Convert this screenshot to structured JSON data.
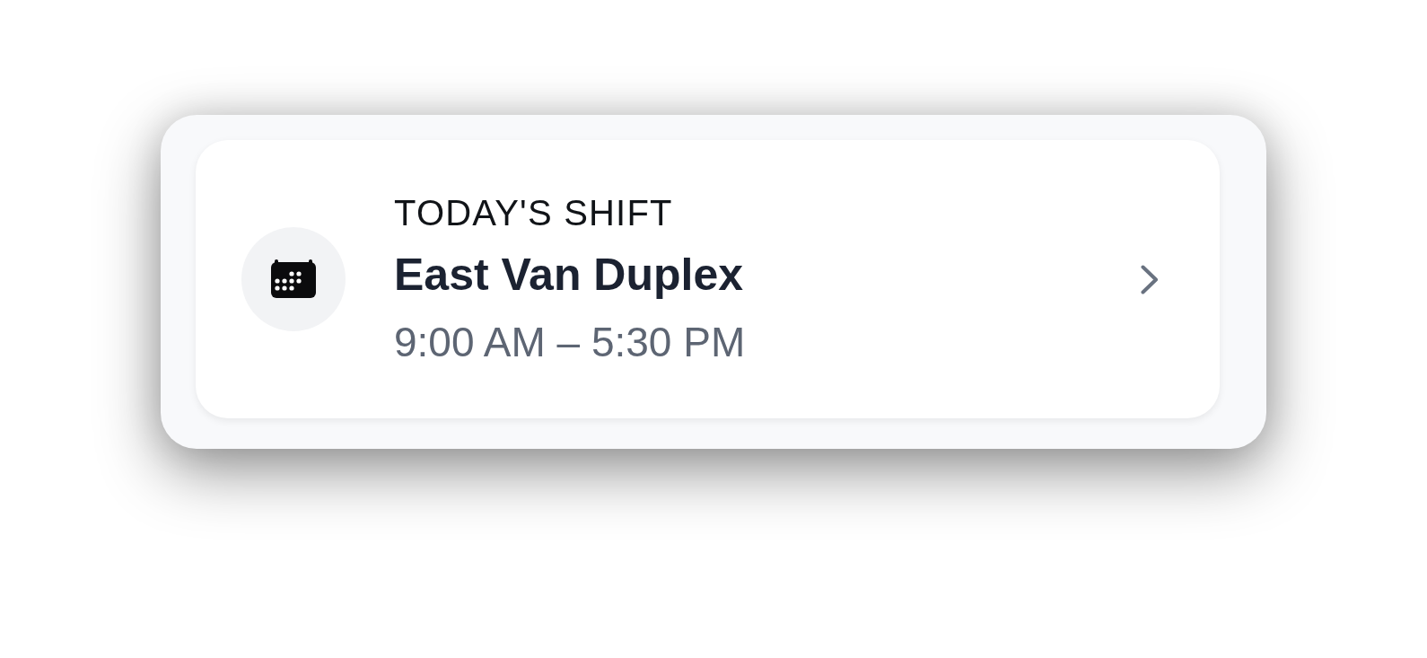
{
  "shift_card": {
    "label": "TODAY'S SHIFT",
    "title": "East Van Duplex",
    "time": "9:00 AM – 5:30 PM"
  }
}
